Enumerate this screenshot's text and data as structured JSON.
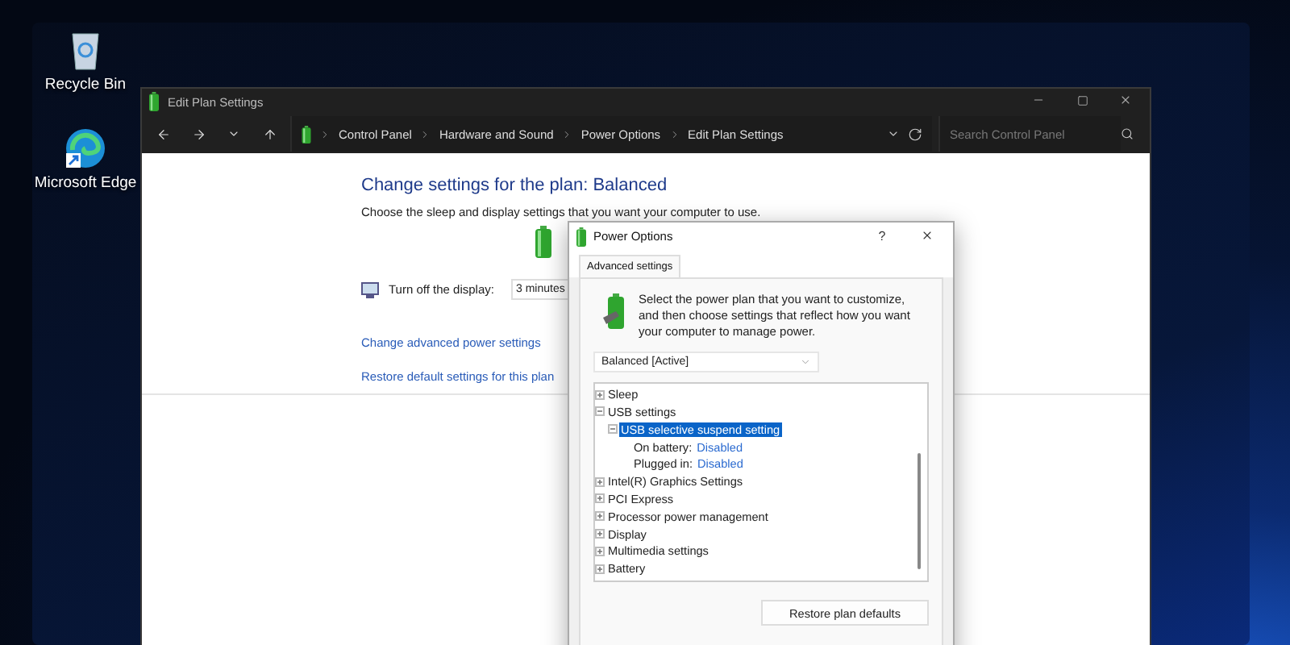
{
  "desktop_icons": [
    {
      "label": "Recycle Bin",
      "kind": "bin"
    },
    {
      "label": "Microsoft Edge",
      "kind": "browser"
    }
  ],
  "window": {
    "title": "Edit Plan Settings",
    "breadcrumb": [
      "Control Panel",
      "Hardware and Sound",
      "Power Options",
      "Edit Plan Settings"
    ],
    "search": {
      "placeholder": "Search Control Panel"
    },
    "heading": "Change settings for the plan: Balanced",
    "description": "Choose the sleep and display settings that you want your computer to use.",
    "display_setting": {
      "label": "Turn off the display:",
      "value": "3 minutes"
    },
    "links": [
      "Change advanced power settings",
      "Restore default settings for this plan"
    ]
  },
  "dialog": {
    "title": "Power Options",
    "help": "?",
    "tabs": [
      {
        "label": "Advanced settings",
        "selected": true
      }
    ],
    "description": "Select the power plan that you want to customize, and then choose settings that reflect how you want your computer to manage power.",
    "plan": "Balanced [Active]",
    "tree": [
      {
        "label": "Sleep",
        "expanded": false,
        "selected": false
      },
      {
        "label": "USB settings",
        "expanded": true,
        "selected": false,
        "children": [
          {
            "label": "USB selective suspend setting",
            "expanded": true,
            "selected": true,
            "children": [
              {
                "label": "On battery:",
                "value": "Disabled"
              },
              {
                "label": "Plugged in:",
                "value": "Disabled"
              }
            ]
          }
        ]
      },
      {
        "label": "Intel(R) Graphics Settings",
        "expanded": false,
        "selected": false
      },
      {
        "label": "PCI Express",
        "expanded": false,
        "selected": false
      },
      {
        "label": "Processor power management",
        "expanded": false,
        "selected": false
      },
      {
        "label": "Display",
        "expanded": false,
        "selected": false
      },
      {
        "label": "Multimedia settings",
        "expanded": false,
        "selected": false
      },
      {
        "label": "Battery",
        "expanded": false,
        "selected": false
      }
    ],
    "button": "Restore plan defaults"
  }
}
